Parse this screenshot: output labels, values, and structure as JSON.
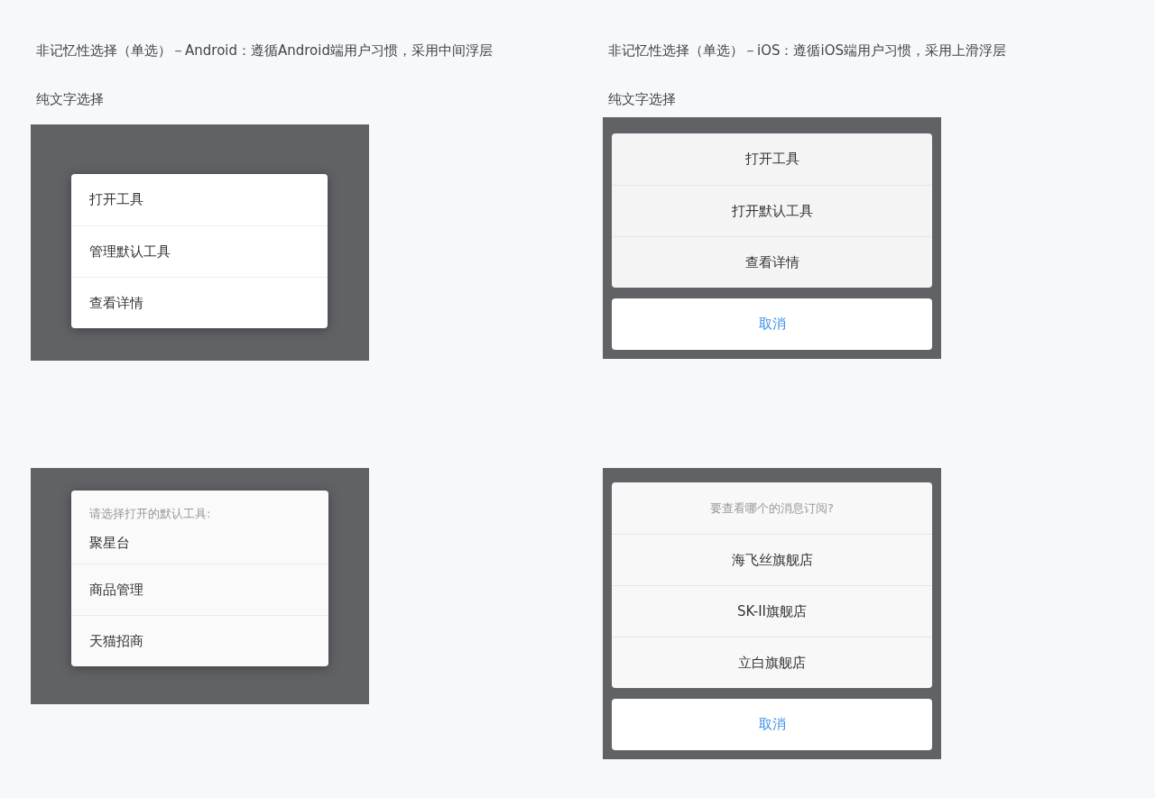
{
  "demos": [
    {
      "kind": "android",
      "title": "非记忆性选择（单选）－Android：遵循Android端用户习惯，采用中间浮层",
      "subtitle": "纯文字选择",
      "items": [
        "打开工具",
        "管理默认工具",
        "查看详情"
      ]
    },
    {
      "kind": "ios",
      "title": "非记忆性选择（单选）－iOS：遵循iOS端用户习惯，采用上滑浮层",
      "subtitle": "纯文字选择",
      "items": [
        "打开工具",
        "打开默认工具",
        "查看详情"
      ],
      "cancel": "取消"
    },
    {
      "kind": "android",
      "prompt": "请选择打开的默认工具:",
      "items": [
        "聚星台",
        "商品管理",
        "天猫招商"
      ]
    },
    {
      "kind": "ios",
      "prompt": "要查看哪个的消息订阅?",
      "items": [
        "海飞丝旗舰店",
        "SK-II旗舰店",
        "立白旗舰店"
      ],
      "cancel": "取消"
    }
  ]
}
